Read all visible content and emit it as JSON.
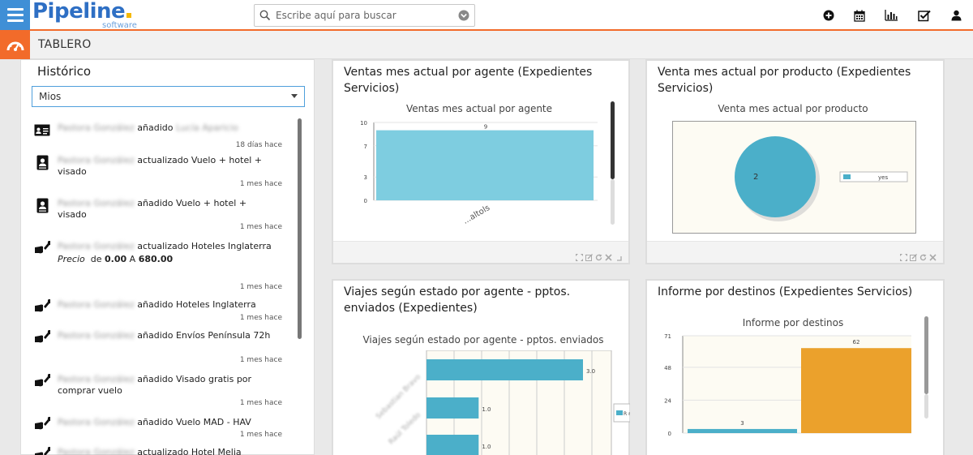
{
  "app": {
    "logo_text": "Pipeline",
    "logo_sub": "software",
    "search_placeholder": "Escribe aquí para buscar",
    "section_title": "TABLERO"
  },
  "historico": {
    "title": "Histórico",
    "filter_value": "Mios",
    "items": [
      {
        "icon": "id-card-icon",
        "user": "Pastora González",
        "action": "añadido",
        "target_blur": "Lucía Aparicio",
        "time": "18 días hace"
      },
      {
        "icon": "contact-book-icon",
        "user": "Pastora González",
        "action": "actualizado Vuelo + hotel + visado",
        "time": "1 mes hace"
      },
      {
        "icon": "contact-book-icon",
        "user": "Pastora González",
        "action": "añadido Vuelo + hotel + visado",
        "time": "1 mes hace"
      },
      {
        "icon": "wrench-hand-icon",
        "user": "Pastora González",
        "action": "actualizado Hoteles Inglaterra",
        "detail_label": "Precio",
        "detail_from_word": "de",
        "detail_from": "0.00",
        "detail_to_word": "A",
        "detail_to": "680.00",
        "time": "1 mes hace"
      },
      {
        "icon": "wrench-hand-icon",
        "user": "Pastora González",
        "action": "añadido Hoteles Inglaterra",
        "time": "1 mes hace"
      },
      {
        "icon": "wrench-hand-icon",
        "user": "Pastora González",
        "action": "añadido Envíos Península 72h",
        "time": "1 mes hace"
      },
      {
        "icon": "wrench-hand-icon",
        "user": "Pastora González",
        "action": "añadido Visado gratis por comprar vuelo",
        "time": "1 mes hace"
      },
      {
        "icon": "wrench-hand-icon",
        "user": "Pastora González",
        "action": "añadido Vuelo MAD - HAV",
        "time": "1 mes hace"
      },
      {
        "icon": "wrench-hand-icon",
        "user": "Pastora González",
        "action": "actualizado Hotel Melia",
        "time": ""
      }
    ]
  },
  "panels": {
    "p1_title": "Ventas mes actual por agente (Expedientes Servicios)",
    "p2_title": "Venta mes actual por producto (Expedientes Servicios)",
    "p3_title": "Viajes según estado por agente - pptos. enviados (Expedientes)",
    "p4_title": "Informe por destinos (Expedientes Servicios)"
  },
  "chart_data": [
    {
      "type": "bar",
      "title": "Ventas mes actual por agente",
      "categories": [
        "...altols"
      ],
      "values": [
        9
      ],
      "data_labels": [
        "9"
      ],
      "yticks": [
        "10",
        "7",
        "3",
        "0"
      ],
      "ylim": [
        0,
        10
      ],
      "color": "#7ecde0"
    },
    {
      "type": "pie",
      "title": "Venta mes actual por producto",
      "slices": [
        {
          "label": "yes",
          "value": 2
        }
      ],
      "data_labels": [
        "2"
      ],
      "legend": "right",
      "color": "#4bafc9"
    },
    {
      "type": "bar",
      "orientation": "horizontal",
      "title": "Viajes según estado por agente - pptos. enviados",
      "categories": [
        "Sebastian Bravo",
        "Raúl Toledo",
        ""
      ],
      "values": [
        3.0,
        1.0,
        1.0
      ],
      "data_labels": [
        "3.0",
        "1.0",
        "1.0"
      ],
      "legend_text": "R re",
      "color": "#4bafc9"
    },
    {
      "type": "bar",
      "title": "Informe por destinos",
      "categories": [
        "",
        ""
      ],
      "values": [
        3,
        62
      ],
      "data_labels": [
        "3",
        "62"
      ],
      "yticks": [
        "71",
        "48",
        "24",
        "0"
      ],
      "ylim": [
        0,
        71
      ],
      "colors": [
        "#4bafc9",
        "#eba12c"
      ]
    }
  ]
}
